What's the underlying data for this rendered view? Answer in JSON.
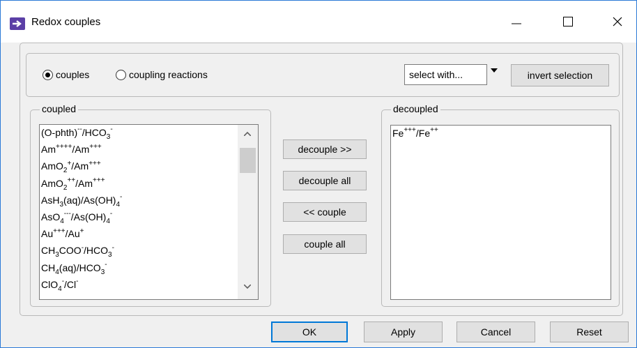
{
  "window": {
    "title": "Redox couples",
    "controls": {
      "minimize": "minimize-icon",
      "maximize": "maximize-icon",
      "close": "close-icon"
    }
  },
  "top": {
    "radio_couples": "couples",
    "radio_coupling_reactions": "coupling reactions",
    "selected_radio": "couples",
    "select_value": "select with...",
    "invert_selection": "invert selection"
  },
  "coupled": {
    "legend": "coupled",
    "items": [
      {
        "parts": [
          [
            "t",
            "(O-phth)"
          ],
          [
            "sup",
            "--"
          ],
          [
            "t",
            "/HCO"
          ],
          [
            "sub",
            "3"
          ],
          [
            "sup",
            "-"
          ]
        ]
      },
      {
        "parts": [
          [
            "t",
            "Am"
          ],
          [
            "sup",
            "++++"
          ],
          [
            "t",
            "/Am"
          ],
          [
            "sup",
            "+++"
          ]
        ]
      },
      {
        "parts": [
          [
            "t",
            "AmO"
          ],
          [
            "sub",
            "2"
          ],
          [
            "sup",
            "+"
          ],
          [
            "t",
            "/Am"
          ],
          [
            "sup",
            "+++"
          ]
        ]
      },
      {
        "parts": [
          [
            "t",
            "AmO"
          ],
          [
            "sub",
            "2"
          ],
          [
            "sup",
            "++"
          ],
          [
            "t",
            "/Am"
          ],
          [
            "sup",
            "+++"
          ]
        ]
      },
      {
        "parts": [
          [
            "t",
            "AsH"
          ],
          [
            "sub",
            "3"
          ],
          [
            "t",
            "(aq)/As(OH)"
          ],
          [
            "sub",
            "4"
          ],
          [
            "sup",
            "-"
          ]
        ]
      },
      {
        "parts": [
          [
            "t",
            "AsO"
          ],
          [
            "sub",
            "4"
          ],
          [
            "sup",
            "---"
          ],
          [
            "t",
            "/As(OH)"
          ],
          [
            "sub",
            "4"
          ],
          [
            "sup",
            "-"
          ]
        ]
      },
      {
        "parts": [
          [
            "t",
            "Au"
          ],
          [
            "sup",
            "+++"
          ],
          [
            "t",
            "/Au"
          ],
          [
            "sup",
            "+"
          ]
        ]
      },
      {
        "parts": [
          [
            "t",
            "CH"
          ],
          [
            "sub",
            "3"
          ],
          [
            "t",
            "COO"
          ],
          [
            "sup",
            "-"
          ],
          [
            "t",
            "/HCO"
          ],
          [
            "sub",
            "3"
          ],
          [
            "sup",
            "-"
          ]
        ]
      },
      {
        "parts": [
          [
            "t",
            "CH"
          ],
          [
            "sub",
            "4"
          ],
          [
            "t",
            "(aq)/HCO"
          ],
          [
            "sub",
            "3"
          ],
          [
            "sup",
            "-"
          ]
        ]
      },
      {
        "parts": [
          [
            "t",
            "ClO"
          ],
          [
            "sub",
            "4"
          ],
          [
            "sup",
            "-"
          ],
          [
            "t",
            "/Cl"
          ],
          [
            "sup",
            "-"
          ]
        ]
      }
    ]
  },
  "decoupled": {
    "legend": "decoupled",
    "items": [
      {
        "parts": [
          [
            "t",
            "Fe"
          ],
          [
            "sup",
            "+++"
          ],
          [
            "t",
            "/Fe"
          ],
          [
            "sup",
            "++"
          ]
        ]
      }
    ]
  },
  "middle_buttons": {
    "decouple": "decouple >>",
    "decouple_all": "decouple all",
    "couple": "<< couple",
    "couple_all": "couple all"
  },
  "footer": {
    "ok": "OK",
    "apply": "Apply",
    "cancel": "Cancel",
    "reset": "Reset"
  },
  "colors": {
    "accent": "#0078d7",
    "app_icon": "#5b3fa6"
  }
}
